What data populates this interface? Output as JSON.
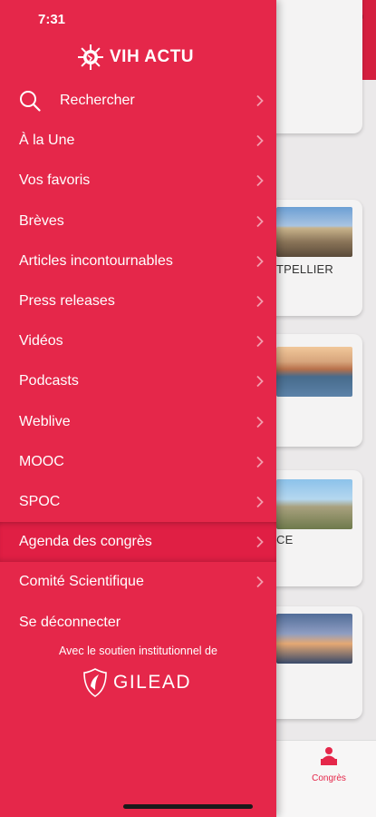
{
  "status_bar": {
    "time": "7:31"
  },
  "brand": {
    "logo_text": "VIH ACTU",
    "accent": "#e5274a"
  },
  "menu": {
    "search_label": "Rechercher",
    "items": [
      "À la Une",
      "Vos favoris",
      "Brèves",
      "Articles incontournables",
      "Press releases",
      "Vidéos",
      "Podcasts",
      "Weblive",
      "MOOC",
      "SPOC",
      "Agenda des congrès",
      "Comité Scientifique",
      "Se déconnecter"
    ],
    "active_index": 10
  },
  "sponsor": {
    "text": "Avec le soutien institutionnel de",
    "logo_text": "GILEAD"
  },
  "background": {
    "cards": [
      "TPELLIER",
      "",
      "CE",
      ""
    ],
    "tab_label": "Congrès"
  }
}
